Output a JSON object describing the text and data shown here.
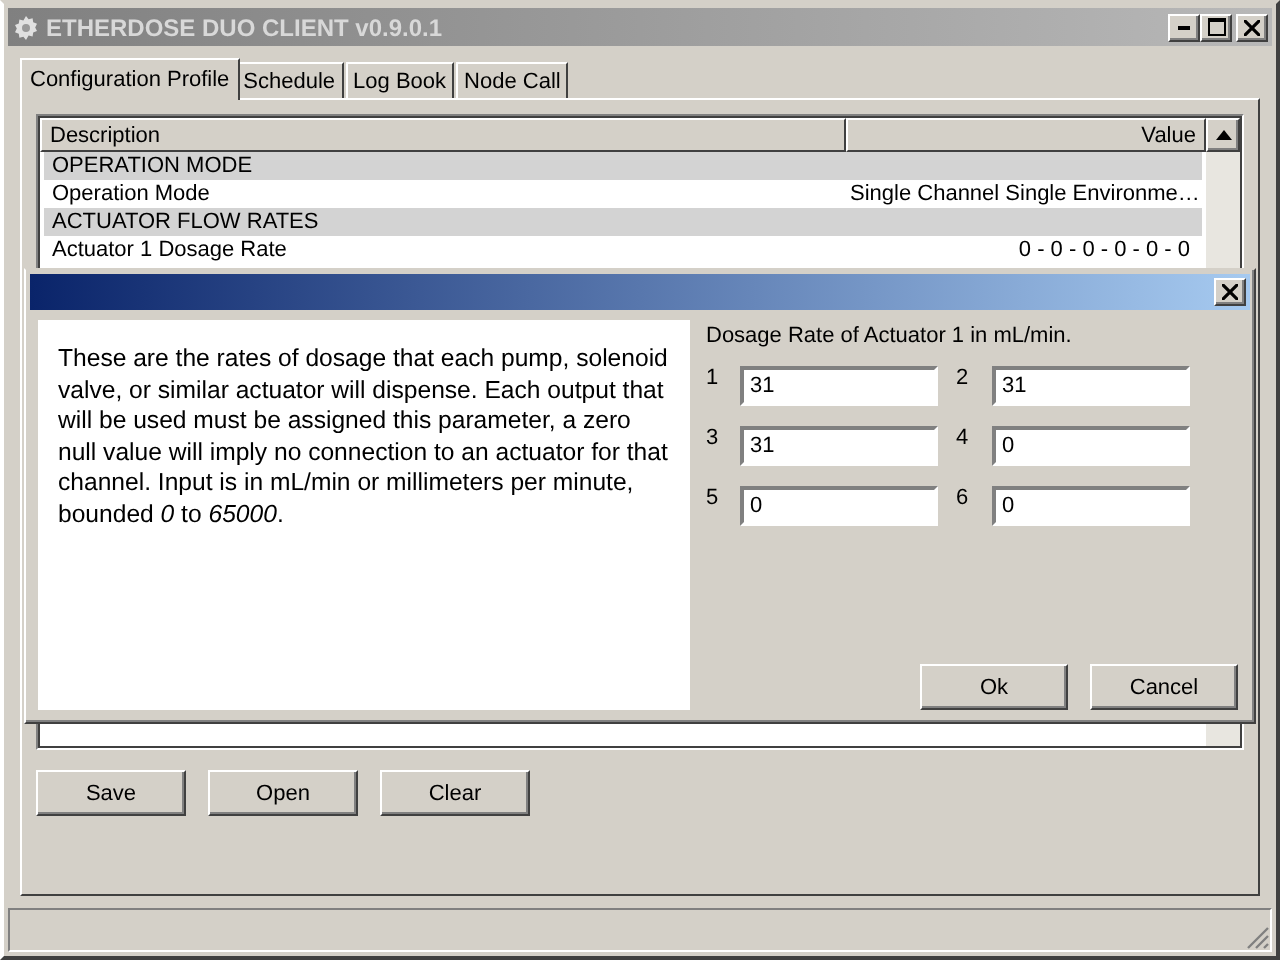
{
  "window": {
    "title": "ETHERDOSE DUO CLIENT v0.9.0.1"
  },
  "tabs": [
    {
      "label": "Configuration Profile",
      "selected": true
    },
    {
      "label": "Schedule",
      "selected": false
    },
    {
      "label": "Log Book",
      "selected": false
    },
    {
      "label": "Node Call",
      "selected": false
    }
  ],
  "table": {
    "columns": [
      "Description",
      "Value"
    ],
    "rows": [
      {
        "kind": "section",
        "description": "OPERATION MODE"
      },
      {
        "kind": "item",
        "description": "Operation Mode",
        "value": "Single Channel Single Environme…"
      },
      {
        "kind": "section",
        "description": "ACTUATOR FLOW RATES"
      },
      {
        "kind": "item",
        "description": "Actuator 1 Dosage Rate",
        "value": "0 - 0 - 0 - 0 - 0 - 0"
      }
    ]
  },
  "buttons": [
    "Save",
    "Open",
    "Clear"
  ],
  "dialog": {
    "help_text": "These are the rates of dosage that each pump, solenoid valve, or similar actuator will dispense. Each output that will be used must be assigned this parameter, a zero null value will imply no connection to an actuator for that channel. Input is in mL/min or millimeters per minute, bounded *0* to *65000*.",
    "prompt": "Dosage Rate of Actuator 1 in mL/min.",
    "fields": [
      {
        "label": "1",
        "value": "31"
      },
      {
        "label": "2",
        "value": "31"
      },
      {
        "label": "3",
        "value": "31"
      },
      {
        "label": "4",
        "value": "0"
      },
      {
        "label": "5",
        "value": "0"
      },
      {
        "label": "6",
        "value": "0"
      }
    ],
    "buttons": [
      "Ok",
      "Cancel"
    ]
  }
}
